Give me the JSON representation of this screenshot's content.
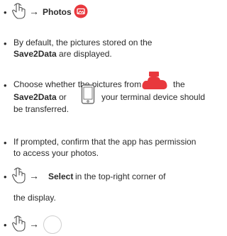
{
  "steps": [
    {
      "action": "Photos"
    },
    {
      "line1": "By default, the pictures stored on the",
      "bold": "Save2Data",
      "rest": " are displayed."
    },
    {
      "line1a": "Choose whether the pictures from",
      "line1b": "the",
      "bold": "Save2Data",
      "line2b": " or",
      "line2c": "your terminal device should",
      "line3": "be transferred."
    },
    {
      "line1": "If prompted, confirm that the app has permission",
      "line2": "to access your photos."
    },
    {
      "action": "Select",
      "rest": " in the top-right corner of",
      "line2": "the display."
    },
    {
      "action": ""
    }
  ],
  "bullet": "•",
  "arrow": "→",
  "colors": {
    "accent": "#e8383d",
    "text": "#2b2b2b",
    "icon_outline": "#555555"
  },
  "icons": [
    "tap-hand-icon",
    "photos-app-icon",
    "save2data-cloud-icon",
    "smartphone-icon",
    "circle-button-icon"
  ]
}
